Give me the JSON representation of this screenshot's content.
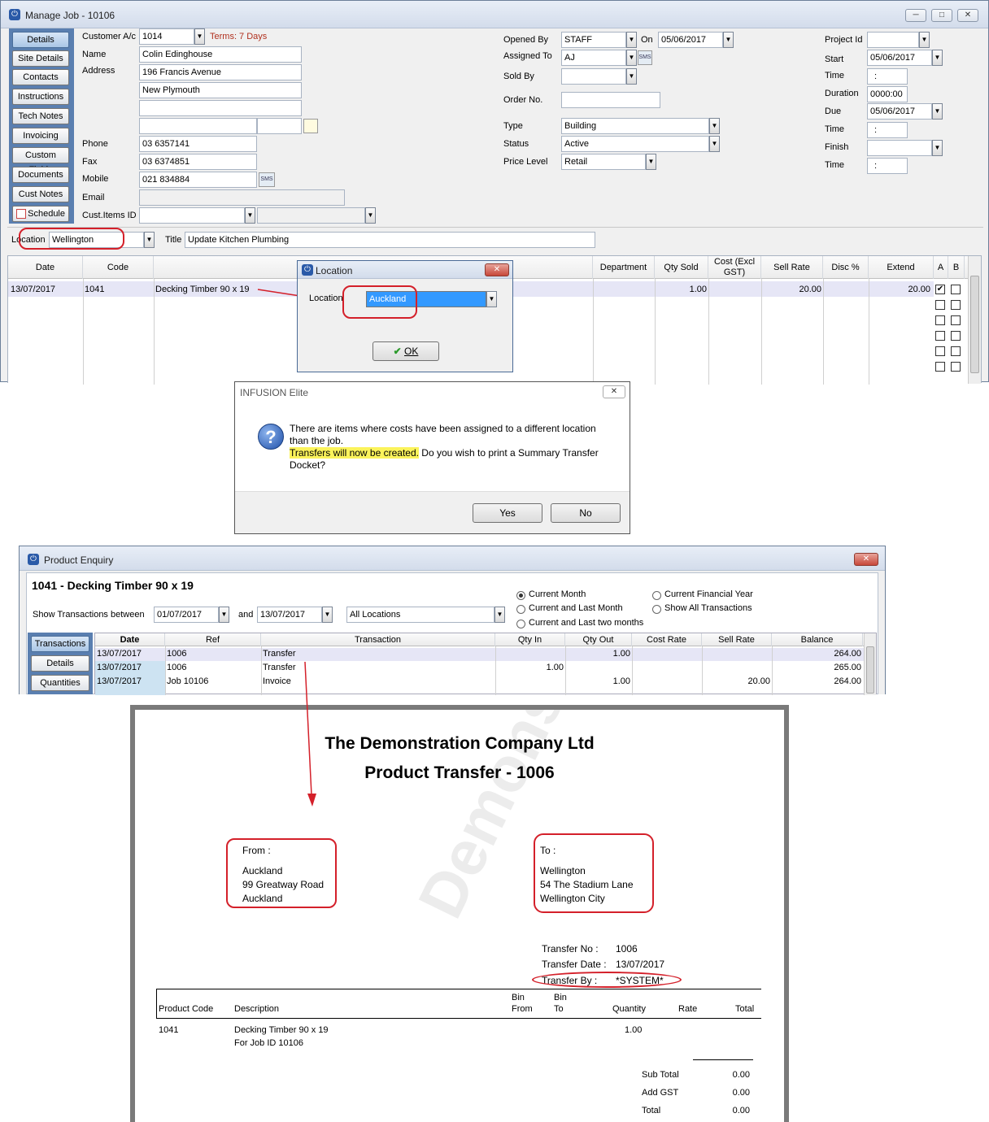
{
  "manage_job": {
    "title": "Manage Job - 10106",
    "nav": [
      "Details",
      "Site Details",
      "Contacts",
      "Instructions",
      "Tech Notes",
      "Invoicing",
      "Custom Fields",
      "Documents",
      "Cust Notes",
      "Schedule"
    ],
    "labels": {
      "customer": "Customer A/c",
      "name": "Name",
      "address": "Address",
      "phone": "Phone",
      "fax": "Fax",
      "mobile": "Mobile",
      "email": "Email",
      "cust_items": "Cust.Items ID",
      "opened_by": "Opened By",
      "on": "On",
      "assigned_to": "Assigned To",
      "sold_by": "Sold By",
      "order_no": "Order No.",
      "type": "Type",
      "status": "Status",
      "price_level": "Price Level",
      "project_id": "Project Id",
      "start": "Start",
      "time": "Time",
      "duration": "Duration",
      "due": "Due",
      "finish": "Finish",
      "location": "Location",
      "job_title": "Title"
    },
    "values": {
      "customer": "1014",
      "terms": "Terms: 7 Days",
      "name": "Colin Edinghouse",
      "address1": "196 Francis Avenue",
      "address2": "New Plymouth",
      "phone": "03 6357141",
      "fax": "03 6374851",
      "mobile": "021 834884",
      "opened_by": "STAFF",
      "on": "05/06/2017",
      "assigned_to": "AJ",
      "type": "Building",
      "status": "Active",
      "price_level": "Retail",
      "start": "05/06/2017",
      "time_sep": ":",
      "duration": "0000:00",
      "due": "05/06/2017",
      "location": "Wellington",
      "job_title": "Update Kitchen Plumbing",
      "sms": "SMS"
    },
    "grid": {
      "headers": {
        "date": "Date",
        "code": "Code",
        "department": "Department",
        "qty_sold": "Qty Sold",
        "cost": "Cost     (Excl GST)",
        "sell_rate": "Sell Rate",
        "disc": "Disc %",
        "extend": "Extend",
        "a": "A",
        "b": "B"
      },
      "row": {
        "date": "13/07/2017",
        "code": "1041",
        "desc": "Decking Timber 90 x 19",
        "qty": "1.00",
        "sell": "20.00",
        "extend": "20.00"
      }
    }
  },
  "location_dialog": {
    "title": "Location",
    "label": "Location",
    "value": "Auckland",
    "ok": "OK"
  },
  "infusion_dialog": {
    "title": "INFUSION Elite",
    "line1": "There are items where costs have been assigned to a different location",
    "line2": "than the job.",
    "highlight": "Transfers will now be created.",
    "line3": " Do you wish to print a Summary Transfer",
    "line4": "Docket?",
    "yes": "Yes",
    "no": "No"
  },
  "product_enquiry": {
    "title": "Product Enquiry",
    "heading": "1041 - Decking Timber 90 x 19",
    "show_between": "Show Transactions between",
    "from": "01/07/2017",
    "and": "and",
    "to": "13/07/2017",
    "locations": "All Locations",
    "radios": {
      "current_month": "Current Month",
      "current_last": "Current and Last Month",
      "current_two": "Current and Last two months",
      "financial": "Current Financial Year",
      "all": "Show All Transactions"
    },
    "tabs": [
      "Transactions",
      "Details",
      "Quantities"
    ],
    "headers": [
      "Date",
      "Ref",
      "Transaction",
      "Qty In",
      "Qty Out",
      "Cost Rate",
      "Sell Rate",
      "Balance"
    ],
    "rows": [
      [
        "13/07/2017",
        "1006",
        "Transfer",
        "",
        "1.00",
        "",
        "",
        "264.00"
      ],
      [
        "13/07/2017",
        "1006",
        "Transfer",
        "1.00",
        "",
        "",
        "",
        "265.00"
      ],
      [
        "13/07/2017",
        "Job 10106",
        "Invoice",
        "",
        "1.00",
        "",
        "20.00",
        "264.00"
      ]
    ]
  },
  "report": {
    "company": "The Demonstration Company Ltd",
    "title": "Product Transfer - 1006",
    "from_label": "From  :",
    "from_lines": [
      "Auckland",
      "99 Greatway Road",
      "Auckland"
    ],
    "to_label": "To :",
    "to_lines": [
      "Wellington",
      "54 The Stadium Lane",
      "Wellington City"
    ],
    "transfer_no_label": "Transfer  No :",
    "transfer_no": "1006",
    "transfer_date_label": "Transfer Date :",
    "transfer_date": "13/07/2017",
    "transfer_by_label": "Transfer By :",
    "transfer_by": "*SYSTEM*",
    "cols": {
      "code": "Product Code",
      "desc": "Description",
      "bin": "Bin",
      "from": "From",
      "to": "To",
      "qty": "Quantity",
      "rate": "Rate",
      "total": "Total"
    },
    "item": {
      "code": "1041",
      "desc": "Decking Timber 90 x 19",
      "desc2": "For Job ID 10106",
      "qty": "1.00"
    },
    "sub_total_label": "Sub Total",
    "sub_total": "0.00",
    "gst_label": "Add GST",
    "gst": "0.00",
    "total_label": "Total",
    "total": "0.00",
    "watermark": "Demonstration Company"
  }
}
